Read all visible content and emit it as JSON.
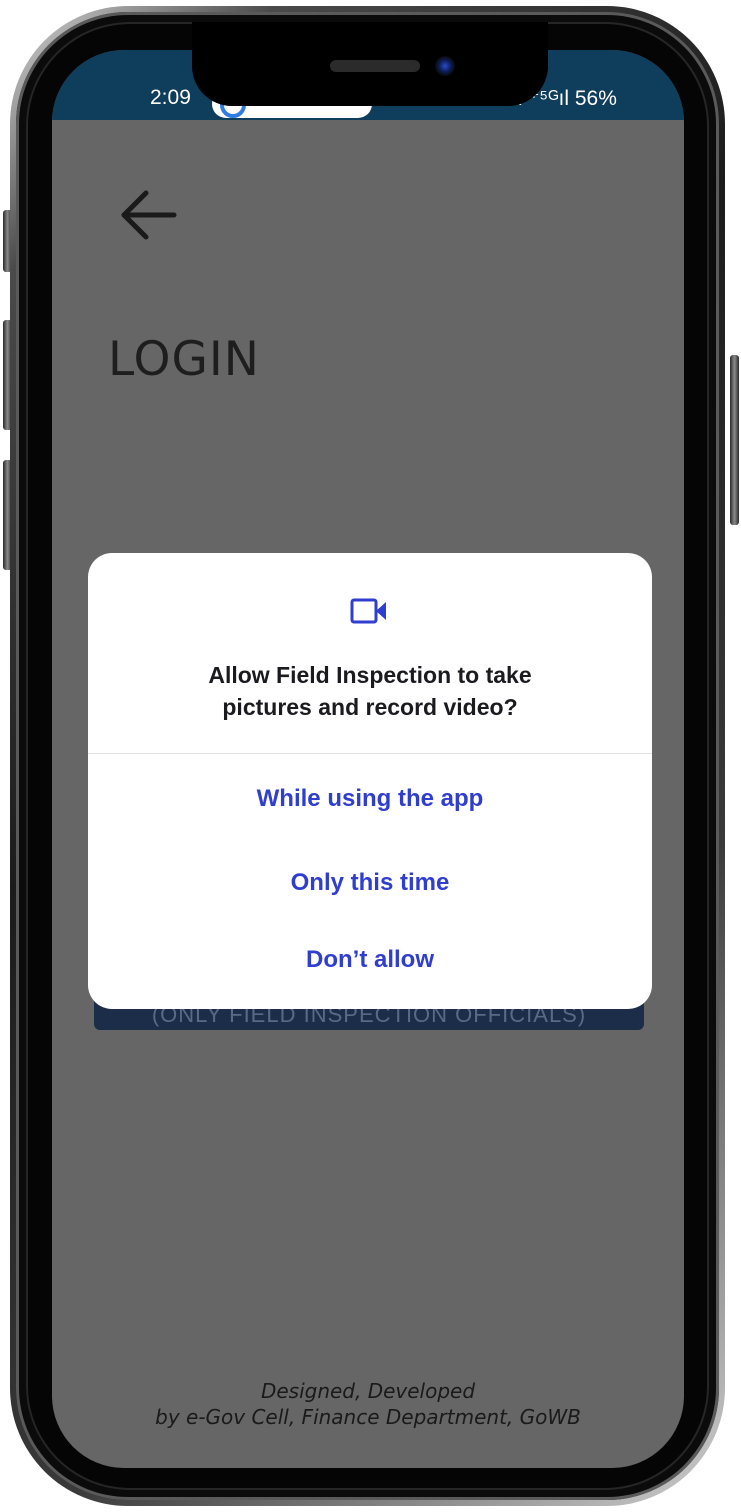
{
  "status_bar": {
    "time": "2:09",
    "right_indicators": "ıl ⁺⁵ᴳıl 56%"
  },
  "page": {
    "title": "LOGIN",
    "background_button_text": "(ONLY FIELD INSPECTION OFFICIALS)",
    "footer_line1": "Designed, Developed",
    "footer_line2": "by e-Gov Cell, Finance Department, GoWB"
  },
  "dialog": {
    "icon": "videocam-icon",
    "title_line1": "Allow Field Inspection to take",
    "title_line2": "pictures and record video?",
    "option_while_using": "While using the app",
    "option_only_this_time": "Only this time",
    "option_dont_allow": "Don’t allow"
  },
  "colors": {
    "status_bar": "#0f3d5c",
    "scrim": "#666666",
    "dialog_accent": "#2f3ecf",
    "button_bg": "#1c2d4a"
  }
}
